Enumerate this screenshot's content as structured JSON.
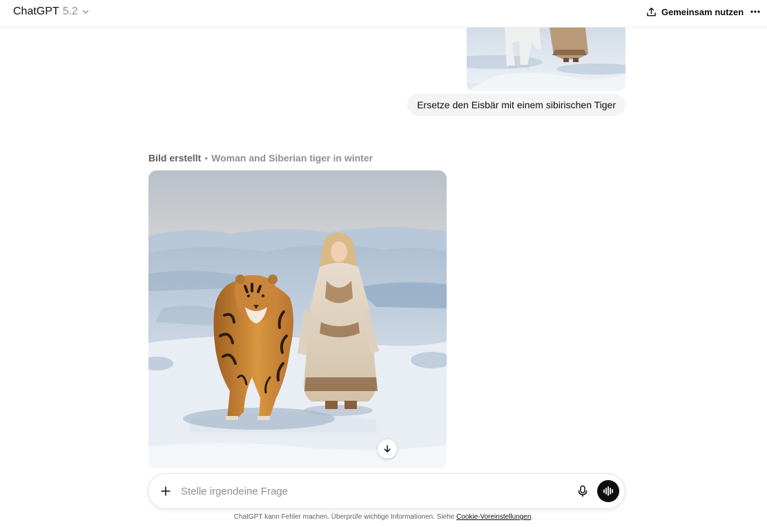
{
  "header": {
    "model_name": "ChatGPT",
    "model_version": "5.2",
    "share_label": "Gemeinsam nutzen",
    "icons": {
      "chevron": "chevron-down-icon",
      "share": "share-upload-icon",
      "more": "more-dots-icon"
    }
  },
  "conversation": {
    "user_message": "Ersetze den Eisbär mit einem sibirischen Tiger",
    "user_image_subject": "polar-bear-and-woman-on-snow",
    "assistant": {
      "status": "Bild erstellt",
      "separator": "•",
      "image_title": "Woman and Siberian tiger in winter",
      "download_icon": "arrow-down-icon"
    }
  },
  "composer": {
    "placeholder": "Stelle irgendeine Frage",
    "value": "",
    "icons": {
      "plus": "plus-icon",
      "mic": "microphone-icon",
      "voice": "voice-waveform-icon"
    }
  },
  "footer": {
    "disclaimer_text": "ChatGPT kann Fehler machen. Überprüfe wichtige Informationen. Siehe",
    "cookie_link": "Cookie-Voreinstellungen",
    "period": "."
  },
  "colors": {
    "bubble_bg": "#f4f4f4",
    "voice_button": "#0d0d0d",
    "muted_text": "#8f8f8f",
    "snow": "#dfe7ef",
    "sky": "#c9d0d8",
    "tiger": "#c98a3e"
  }
}
